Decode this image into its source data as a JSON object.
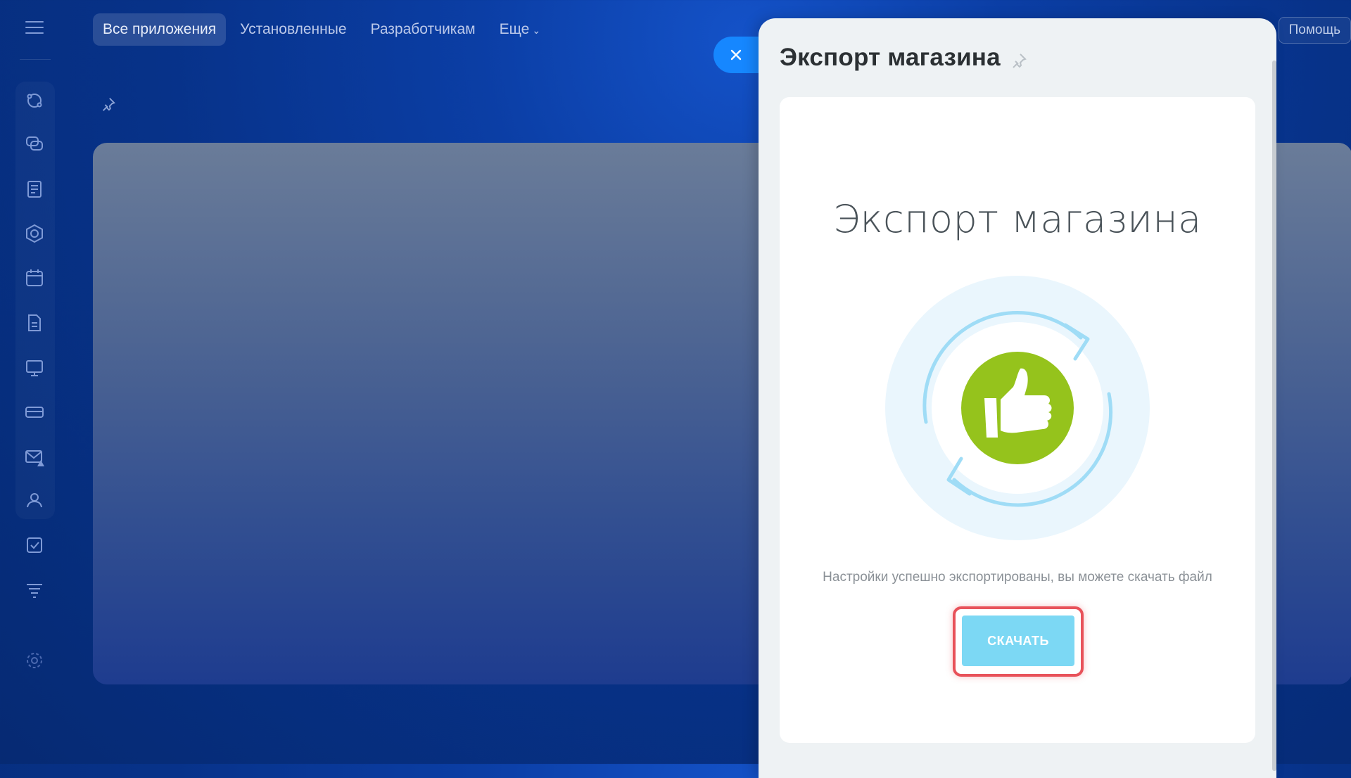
{
  "topnav": {
    "tabs": [
      {
        "label": "Все приложения",
        "active": true
      },
      {
        "label": "Установленные"
      },
      {
        "label": "Разработчикам"
      },
      {
        "label": "Еще"
      }
    ],
    "help_label": "Помощь"
  },
  "sidebar": {
    "icons": [
      "crm-icon",
      "chat-icon",
      "feed-icon",
      "hexagon-icon",
      "calendar-icon",
      "document-icon",
      "presentation-icon",
      "inventory-icon",
      "mail-icon",
      "contacts-icon",
      "tasks-icon",
      "filter-icon",
      "settings-icon"
    ]
  },
  "slider": {
    "title": "Экспорт магазина",
    "heading": "Экспорт магазина",
    "message": "Настройки успешно экспортированы, вы можете скачать файл",
    "download_label": "СКАЧАТЬ"
  },
  "colors": {
    "accent": "#1687ff",
    "download_button": "#7cd8f4",
    "thumbs_green": "#95c31c",
    "highlight_red": "#e8525a"
  }
}
